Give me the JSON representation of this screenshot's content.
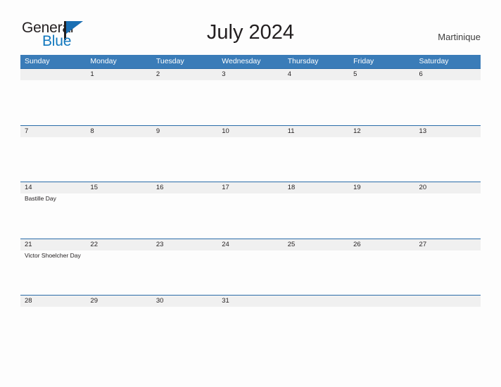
{
  "brand": {
    "name_part1": "General",
    "name_part2": "Blue",
    "flag_icon": "flag-triangle-icon",
    "accent_color": "#1278be"
  },
  "header": {
    "title": "July 2024",
    "locale": "Martinique"
  },
  "colors": {
    "header_row_bg": "#3a7cb8",
    "date_band_bg": "#f0f0f0",
    "date_band_border": "#2a6ca8",
    "page_bg": "#fdfdfd",
    "text": "#231f20"
  },
  "calendar": {
    "weekdays": [
      "Sunday",
      "Monday",
      "Tuesday",
      "Wednesday",
      "Thursday",
      "Friday",
      "Saturday"
    ],
    "weeks": [
      {
        "days": [
          {
            "date": "",
            "events": []
          },
          {
            "date": "1",
            "events": []
          },
          {
            "date": "2",
            "events": []
          },
          {
            "date": "3",
            "events": []
          },
          {
            "date": "4",
            "events": []
          },
          {
            "date": "5",
            "events": []
          },
          {
            "date": "6",
            "events": []
          }
        ]
      },
      {
        "days": [
          {
            "date": "7",
            "events": []
          },
          {
            "date": "8",
            "events": []
          },
          {
            "date": "9",
            "events": []
          },
          {
            "date": "10",
            "events": []
          },
          {
            "date": "11",
            "events": []
          },
          {
            "date": "12",
            "events": []
          },
          {
            "date": "13",
            "events": []
          }
        ]
      },
      {
        "days": [
          {
            "date": "14",
            "events": [
              "Bastille Day"
            ]
          },
          {
            "date": "15",
            "events": []
          },
          {
            "date": "16",
            "events": []
          },
          {
            "date": "17",
            "events": []
          },
          {
            "date": "18",
            "events": []
          },
          {
            "date": "19",
            "events": []
          },
          {
            "date": "20",
            "events": []
          }
        ]
      },
      {
        "days": [
          {
            "date": "21",
            "events": [
              "Victor Shoelcher Day"
            ]
          },
          {
            "date": "22",
            "events": []
          },
          {
            "date": "23",
            "events": []
          },
          {
            "date": "24",
            "events": []
          },
          {
            "date": "25",
            "events": []
          },
          {
            "date": "26",
            "events": []
          },
          {
            "date": "27",
            "events": []
          }
        ]
      },
      {
        "days": [
          {
            "date": "28",
            "events": []
          },
          {
            "date": "29",
            "events": []
          },
          {
            "date": "30",
            "events": []
          },
          {
            "date": "31",
            "events": []
          },
          {
            "date": "",
            "events": []
          },
          {
            "date": "",
            "events": []
          },
          {
            "date": "",
            "events": []
          }
        ]
      }
    ]
  }
}
